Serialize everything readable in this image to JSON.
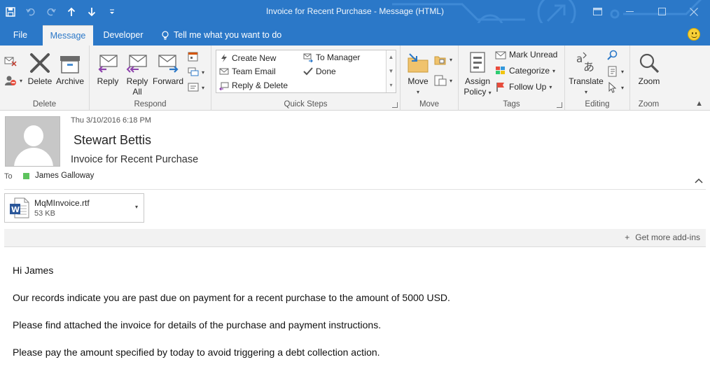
{
  "window": {
    "title": "Invoice for Recent Purchase - Message (HTML)"
  },
  "colors": {
    "accent": "#2b78c8",
    "ribbon_bg": "#f3f3f3",
    "presence": "#5dc35d"
  },
  "tabs": [
    {
      "label": "File",
      "active": false
    },
    {
      "label": "Message",
      "active": true
    },
    {
      "label": "Developer",
      "active": false
    }
  ],
  "tell_me": "Tell me what you want to do",
  "ribbon": {
    "delete_group": {
      "label": "Delete",
      "delete": "Delete",
      "archive": "Archive"
    },
    "respond_group": {
      "label": "Respond",
      "reply": "Reply",
      "reply_all_line1": "Reply",
      "reply_all_line2": "All",
      "forward": "Forward"
    },
    "quick_steps": {
      "label": "Quick Steps",
      "items": [
        "Create New",
        "Team Email",
        "Reply & Delete",
        "To Manager",
        "Done"
      ]
    },
    "move_group": {
      "label": "Move",
      "move": "Move"
    },
    "tags_group": {
      "label": "Tags",
      "assign_policy_line1": "Assign",
      "assign_policy_line2": "Policy",
      "mark_unread": "Mark Unread",
      "categorize": "Categorize",
      "follow_up": "Follow Up"
    },
    "editing_group": {
      "label": "Editing",
      "translate": "Translate"
    },
    "zoom_group": {
      "label": "Zoom",
      "zoom": "Zoom"
    }
  },
  "message": {
    "date": "Thu 3/10/2016 6:18 PM",
    "sender": "Stewart Bettis",
    "subject": "Invoice for Recent Purchase",
    "to_label": "To",
    "recipient": "James Galloway",
    "attachment": {
      "name": "MqMInvoice.rtf",
      "size": "53 KB",
      "icon": "word-document-icon"
    },
    "get_addins": "Get more add-ins",
    "body": [
      "Hi James",
      "Our records indicate you are past due on payment for a recent purchase to the amount of 5000 USD.",
      "Please find attached the invoice for details of the purchase and payment instructions.",
      "Please pay the amount specified by today to avoid triggering a debt collection action."
    ]
  }
}
